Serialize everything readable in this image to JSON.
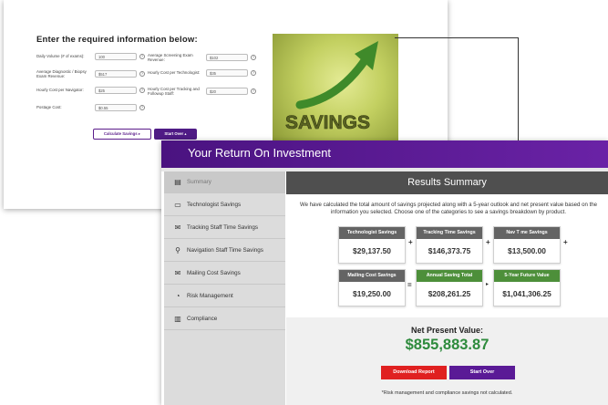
{
  "form": {
    "title": "Enter the required information below:",
    "fields": [
      {
        "label": "Daily Volume (# of exams):",
        "value": "100"
      },
      {
        "label": "Average Screening Exam Revenue:",
        "value": "$102"
      },
      {
        "label": "Average Diagnostic / Biopsy Exam Revenue:",
        "value": "$517"
      },
      {
        "label": "Hourly Cost per Technologist:",
        "value": "$35"
      },
      {
        "label": "Hourly Cost per Navigator:",
        "value": "$25"
      },
      {
        "label": "Hourly Cost per Tracking and Followup Staff:",
        "value": "$20"
      },
      {
        "label": "Postage Cost:",
        "value": "$0.55"
      }
    ],
    "help_glyph": "?",
    "calculate_label": "Calculate Savings ▸",
    "start_over_label": "Start Over ▴",
    "image_word": "SAVINGS"
  },
  "roi": {
    "title": "Your Return On Investment",
    "results_title": "Results Summary",
    "description": "We have calculated the total amount of savings projected along with a 5-year outlook and net present value based on the information you selected. Choose one of the categories to see a savings breakdown by product.",
    "sidebar": [
      {
        "label": "Summary",
        "icon": "summary-icon",
        "glyph": "▤"
      },
      {
        "label": "Technologist Savings",
        "icon": "technologist-icon",
        "glyph": "▭"
      },
      {
        "label": "Tracking Staff Time Savings",
        "icon": "tracking-icon",
        "glyph": "✉"
      },
      {
        "label": "Navigation Staff Time Savings",
        "icon": "map-pin-icon",
        "glyph": "⚲"
      },
      {
        "label": "Mailing Cost Savings",
        "icon": "mail-icon",
        "glyph": "✉"
      },
      {
        "label": "Risk Management",
        "icon": "gauge-icon",
        "glyph": "◔"
      },
      {
        "label": "Compliance",
        "icon": "clipboard-icon",
        "glyph": "▥"
      }
    ],
    "boxes": [
      {
        "title": "Technologist Savings",
        "value": "$29,137.50"
      },
      {
        "title": "Tracking Time Savings",
        "value": "$146,373.75"
      },
      {
        "title": "Nav T me Savings",
        "value": "$13,500.00"
      },
      {
        "title": "Mailing Cost Savings",
        "value": "$19,250.00"
      },
      {
        "title": "Annual Saving Total",
        "value": "$208,261.25"
      },
      {
        "title": "5-Year Future Value",
        "value": "$1,041,306.25"
      }
    ],
    "operators": {
      "plus": "+",
      "equals": "=",
      "arrow": "▸"
    },
    "npv_label": "Net Present Value:",
    "npv_value": "$855,883.87",
    "download_label": "Download Report",
    "start_over_label": "Start Over",
    "note": "*Risk management and compliance savings not calculated."
  },
  "colors": {
    "header_purple": "#5a1a96",
    "npv_green": "#2e8b3d",
    "download_red": "#e02020",
    "green_box_header": "#4d8f3a",
    "gray_box_header": "#646464"
  }
}
